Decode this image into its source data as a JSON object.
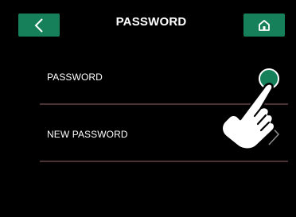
{
  "header": {
    "title": "PASSWORD",
    "back_icon": "chevron-left-icon",
    "home_icon": "home-icon"
  },
  "menu": {
    "items": [
      {
        "label": "PASSWORD"
      },
      {
        "label": "NEW PASSWORD",
        "icon": "chevron-right-icon"
      }
    ]
  },
  "overlay": {
    "icon": "pointing-hand-icon"
  },
  "colors": {
    "background": "#000000",
    "accent": "#16805a",
    "divider": "#4a3334",
    "text": "#ffffff"
  }
}
